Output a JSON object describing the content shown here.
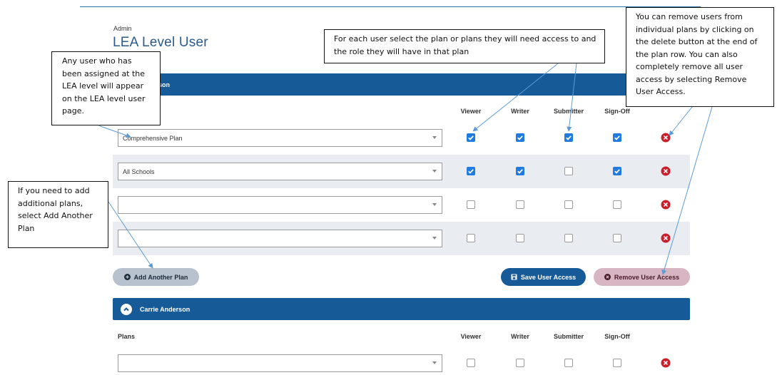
{
  "header": {
    "breadcrumb": "Admin",
    "title": "LEA Level User"
  },
  "columns": [
    "Viewer",
    "Writer",
    "Submitter",
    "Sign-Off"
  ],
  "plans_label": "Plans",
  "users": [
    {
      "name": "Anderson",
      "collapse_icon": "chevron-up-icon",
      "rows": [
        {
          "plan": "Comprehensive Plan",
          "roles": [
            true,
            true,
            true,
            true
          ]
        },
        {
          "plan": "All Schools",
          "roles": [
            true,
            true,
            false,
            true
          ]
        },
        {
          "plan": "",
          "roles": [
            false,
            false,
            false,
            false
          ]
        },
        {
          "plan": "",
          "roles": [
            false,
            false,
            false,
            false
          ]
        }
      ]
    },
    {
      "name": "Carrie Anderson",
      "collapse_icon": "chevron-up-icon",
      "rows": [
        {
          "plan": "",
          "roles": [
            false,
            false,
            false,
            false
          ]
        }
      ]
    }
  ],
  "buttons": {
    "add_plan": "Add Another Plan",
    "save": "Save User Access",
    "remove": "Remove User Access"
  },
  "callouts": {
    "lea_user": "Any user who has been assigned at the LEA level will appear on the LEA level user page.",
    "select_plan": "For each user select the plan or plans they will need access to and the role they will have in that plan",
    "remove_users": "You can remove users from individual plans by clicking on the delete button at the end of the plan row. You can also completely remove all user access by selecting Remove User Access.",
    "add_plans": "If you need to add additional plans, select Add Another Plan"
  },
  "colors": {
    "primary": "#175a98",
    "checkbox": "#1f7be0",
    "delete": "#c81f2a",
    "annotation_arrow": "#5b9bd5"
  }
}
